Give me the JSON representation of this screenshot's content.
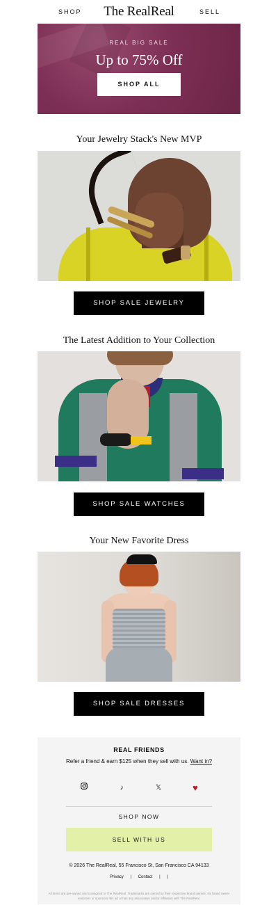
{
  "nav": {
    "shop": "SHOP",
    "logo": "The RealReal",
    "sell": "SELL"
  },
  "hero": {
    "eyebrow": "REAL BIG SALE",
    "headline": "Up to 75% Off",
    "cta": "SHOP ALL",
    "bg_color": "#7d2f55"
  },
  "sections": [
    {
      "title": "Your Jewelry Stack's New MVP",
      "cta": "SHOP SALE JEWELRY"
    },
    {
      "title": "The Latest Addition to Your Collection",
      "cta": "SHOP SALE WATCHES"
    },
    {
      "title": "Your New Favorite Dress",
      "cta": "SHOP SALE DRESSES"
    }
  ],
  "footer": {
    "title": "REAL FRIENDS",
    "refer_text": "Refer a friend & earn $125 when they sell with us.",
    "refer_link": "Want in?",
    "social_icons": [
      "instagram-icon",
      "tiktok-icon",
      "x-icon",
      "heart-icon"
    ],
    "shop_now": "SHOP NOW",
    "sell_with_us": "SELL WITH US",
    "sell_color": "#e3f0a8",
    "copyright": "© 2026 The RealReal, 55 Francisco St, San Francisco CA 94133",
    "links": {
      "privacy": "Privacy",
      "sep": "|",
      "contact": "Contact",
      "sep2": "|",
      "sep3": "|"
    },
    "disclaimer": "All items are pre-owned and consigned to The RealReal. Trademarks are owned by their respective brand owners. No brand owner endorses or sponsors this ad or has any association and/or affiliation with The RealReal."
  }
}
